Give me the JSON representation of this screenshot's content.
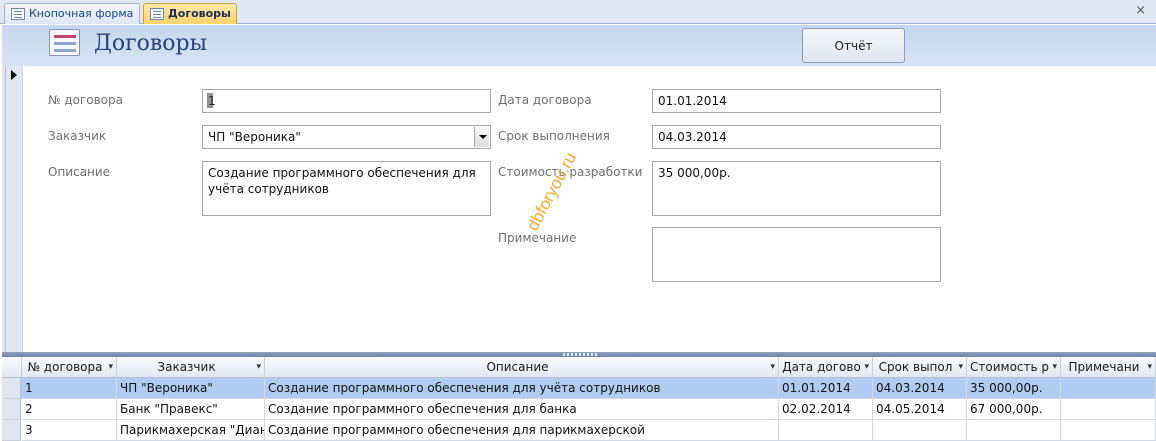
{
  "tabs": [
    {
      "label": "Кнопочная форма",
      "active": false
    },
    {
      "label": "Договоры",
      "active": true
    }
  ],
  "close_glyph": "×",
  "form": {
    "title": "Договоры",
    "report_button": "Отчёт",
    "fields": {
      "contract_no": {
        "label": "№ договора",
        "value": "1"
      },
      "customer": {
        "label": "Заказчик",
        "value": "ЧП \"Вероника\""
      },
      "description": {
        "label": "Описание",
        "value": "Создание программного обеспечения для учёта сотрудников"
      },
      "contract_date": {
        "label": "Дата договора",
        "value": "01.01.2014"
      },
      "deadline": {
        "label": "Срок выполнения",
        "value": "04.03.2014"
      },
      "cost": {
        "label": "Стоимость разработки",
        "value": "35 000,00р."
      },
      "note": {
        "label": "Примечание",
        "value": ""
      }
    }
  },
  "watermark": "dbforyou.ru",
  "datasheet": {
    "columns": [
      "№ договора",
      "Заказчик",
      "Описание",
      "Дата догово",
      "Срок выпол",
      "Стоимость р",
      "Примечани"
    ],
    "rows": [
      {
        "no": "1",
        "customer": "ЧП \"Вероника\"",
        "description": "Создание программного обеспечения для учёта сотрудников",
        "date": "01.01.2014",
        "deadline": "04.03.2014",
        "cost": "35 000,00р.",
        "note": ""
      },
      {
        "no": "2",
        "customer": "Банк \"Правекс\"",
        "description": "Создание программного обеспечения для банка",
        "date": "02.02.2014",
        "deadline": "04.05.2014",
        "cost": "67 000,00р.",
        "note": ""
      },
      {
        "no": "3",
        "customer": "Парикмахерская \"Диана\"",
        "description": "Создание программного обеспечения для парикмахерской",
        "date": "",
        "deadline": "",
        "cost": "",
        "note": ""
      }
    ],
    "selected_row": 0
  },
  "colors": {
    "header_bg": "#c5d7ee",
    "title": "#27417a",
    "active_tab": "#ffd26a",
    "selected_row": "#b0cdf1",
    "watermark": "#f5a21a"
  }
}
